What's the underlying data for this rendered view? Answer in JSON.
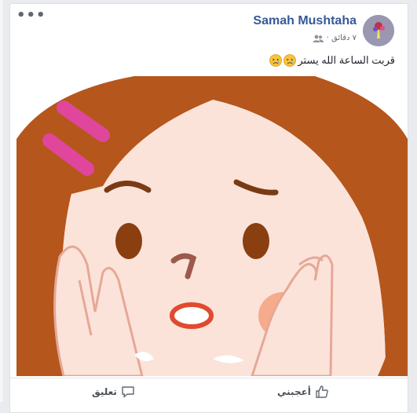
{
  "post": {
    "author": "Samah Mushtaha",
    "time": "٧ دقائق ·",
    "text": "قربت الساعة الله يستر",
    "privacy_icon": "friends-icon",
    "emoji_icon": "sad-face-icon"
  },
  "actions": {
    "like_label": "أعجبني",
    "comment_label": "تعليق"
  },
  "colors": {
    "author_link": "#365899",
    "hair": "#b5561c",
    "skin": "#fbe3da",
    "hair_clip": "#e0469b"
  }
}
